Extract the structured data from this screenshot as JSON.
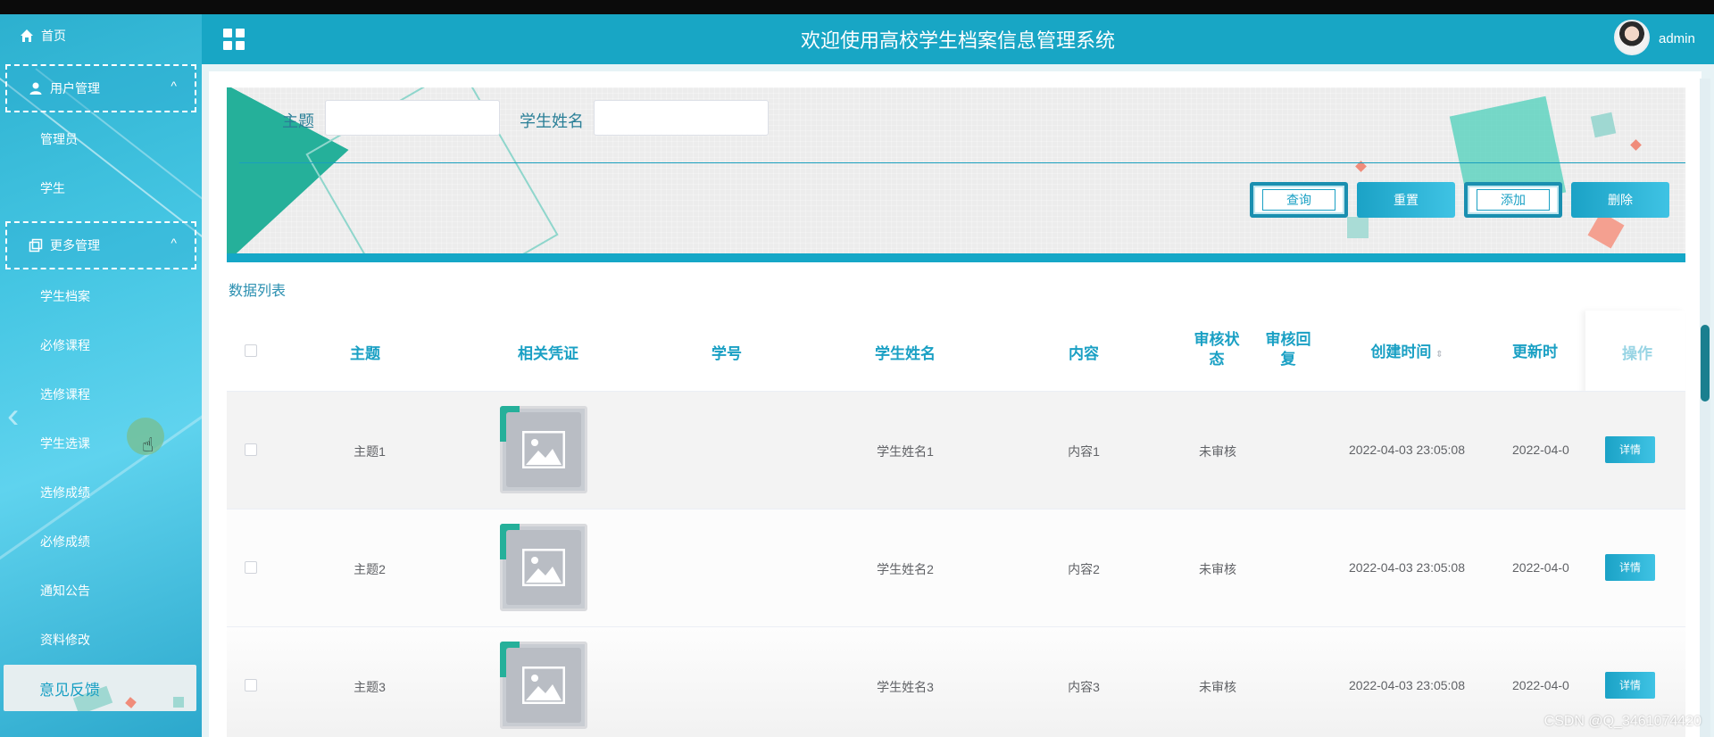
{
  "header": {
    "title": "欢迎使用高校学生档案信息管理系统",
    "username": "admin"
  },
  "sidebar": {
    "home": "首页",
    "group1": {
      "label": "用户管理",
      "items": [
        "管理员",
        "学生"
      ]
    },
    "group2": {
      "label": "更多管理",
      "items": [
        "学生档案",
        "必修课程",
        "选修课程",
        "学生选课",
        "选修成绩",
        "必修成绩",
        "通知公告",
        "资料修改"
      ]
    },
    "feedback": "意见反馈"
  },
  "search": {
    "subject_label": "主题",
    "student_name_label": "学生姓名",
    "subject_value": "",
    "student_name_value": "",
    "buttons": {
      "query": "查询",
      "reset": "重置",
      "add": "添加",
      "delete": "删除"
    }
  },
  "list_title": "数据列表",
  "table": {
    "headers": {
      "subject": "主题",
      "evidence": "相关凭证",
      "student_no": "学号",
      "student_name": "学生姓名",
      "content": "内容",
      "review_status": "审核状态",
      "review_reply": "审核回复",
      "created": "创建时间",
      "updated": "更新时",
      "actions": "操作"
    },
    "rows": [
      {
        "subject": "主题1",
        "student_no": "",
        "student_name": "学生姓名1",
        "content": "内容1",
        "review_status": "未审核",
        "review_reply": "",
        "created": "2022-04-03 23:05:08",
        "updated": "2022-04-0",
        "action": "详情"
      },
      {
        "subject": "主题2",
        "student_no": "",
        "student_name": "学生姓名2",
        "content": "内容2",
        "review_status": "未审核",
        "review_reply": "",
        "created": "2022-04-03 23:05:08",
        "updated": "2022-04-0",
        "action": "详情"
      },
      {
        "subject": "主题3",
        "student_no": "",
        "student_name": "学生姓名3",
        "content": "内容3",
        "review_status": "未审核",
        "review_reply": "",
        "created": "2022-04-03 23:05:08",
        "updated": "2022-04-0",
        "action": "详情"
      }
    ]
  },
  "watermark": "CSDN @Q_3461074420",
  "colors": {
    "primary": "#18a6c5",
    "accent_teal": "#25b09a",
    "header_text": "#1aa0c4"
  }
}
